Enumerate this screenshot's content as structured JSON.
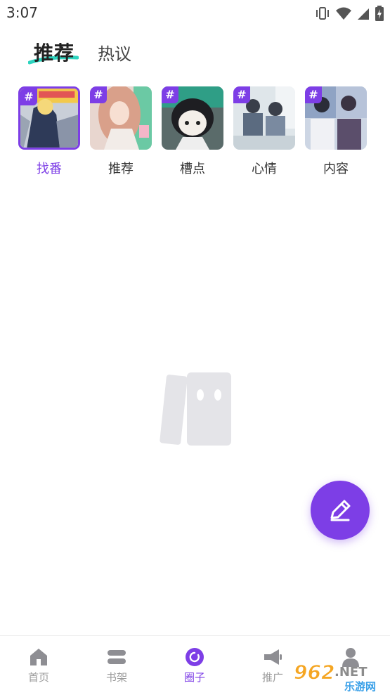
{
  "status_bar": {
    "time": "3:07",
    "icons": [
      "vibrate-icon",
      "wifi-icon",
      "signal-icon",
      "battery-icon"
    ]
  },
  "top_tabs": [
    {
      "label": "推荐",
      "active": true
    },
    {
      "label": "热议",
      "active": false
    }
  ],
  "topics": [
    {
      "label": "找番",
      "badge": "#",
      "selected": true
    },
    {
      "label": "推荐",
      "badge": "#",
      "selected": false
    },
    {
      "label": "槽点",
      "badge": "#",
      "selected": false
    },
    {
      "label": "心情",
      "badge": "#",
      "selected": false
    },
    {
      "label": "内容",
      "badge": "#",
      "selected": false
    }
  ],
  "fab": {
    "icon": "pencil-icon"
  },
  "bottom_nav": [
    {
      "label": "首页",
      "icon": "home-icon",
      "active": false
    },
    {
      "label": "书架",
      "icon": "bookshelf-icon",
      "active": false
    },
    {
      "label": "圈子",
      "icon": "circle-icon",
      "active": true
    },
    {
      "label": "推广",
      "icon": "megaphone-icon",
      "active": false
    },
    {
      "label": "",
      "icon": "user-icon",
      "active": false
    }
  ],
  "watermark": {
    "number": "962",
    "suffix": ".NET",
    "sub": "乐游网"
  },
  "colors": {
    "accent": "#7d3ee6",
    "inactive": "#9b9b9b",
    "underline": "#2dd4bf"
  }
}
